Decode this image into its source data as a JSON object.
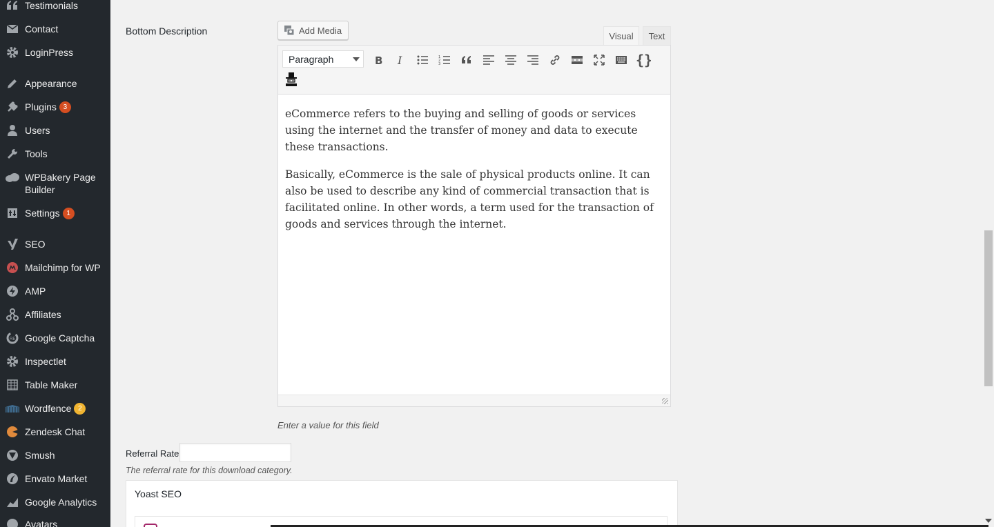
{
  "sidebar": {
    "items": [
      {
        "label": "Testimonials",
        "icon": "quote-icon",
        "badge": ""
      },
      {
        "label": "Contact",
        "icon": "envelope-icon",
        "badge": ""
      },
      {
        "label": "LoginPress",
        "icon": "gear-icon",
        "badge": ""
      },
      {
        "label": "Appearance",
        "icon": "paintbrush-icon",
        "badge": ""
      },
      {
        "label": "Plugins",
        "icon": "plug-icon",
        "badge": "3"
      },
      {
        "label": "Users",
        "icon": "user-icon",
        "badge": ""
      },
      {
        "label": "Tools",
        "icon": "wrench-icon",
        "badge": ""
      },
      {
        "label": "WPBakery Page Builder",
        "icon": "cloud-icon",
        "badge": ""
      },
      {
        "label": "Settings",
        "icon": "settings-icon",
        "badge": "1"
      },
      {
        "label": "SEO",
        "icon": "yoast-icon",
        "badge": ""
      },
      {
        "label": "Mailchimp for WP",
        "icon": "mailchimp-icon",
        "badge": ""
      },
      {
        "label": "AMP",
        "icon": "bolt-icon",
        "badge": ""
      },
      {
        "label": "Affiliates",
        "icon": "network-icon",
        "badge": ""
      },
      {
        "label": "Google Captcha",
        "icon": "recaptcha-icon",
        "badge": ""
      },
      {
        "label": "Inspectlet",
        "icon": "gear-icon",
        "badge": ""
      },
      {
        "label": "Table Maker",
        "icon": "table-icon",
        "badge": ""
      },
      {
        "label": "Wordfence",
        "icon": "wordfence-icon",
        "badge": "2"
      },
      {
        "label": "Zendesk Chat",
        "icon": "zendesk-icon",
        "badge": ""
      },
      {
        "label": "Smush",
        "icon": "smush-icon",
        "badge": ""
      },
      {
        "label": "Envato Market",
        "icon": "leaf-icon",
        "badge": ""
      },
      {
        "label": "Google Analytics",
        "icon": "chart-icon",
        "badge": ""
      },
      {
        "label": "Avatars",
        "icon": "avatar-icon",
        "badge": ""
      }
    ]
  },
  "fields": {
    "bottom_description_label": "Bottom Description",
    "add_media_label": "Add Media",
    "tab_visual": "Visual",
    "tab_text": "Text",
    "format_select_value": "Paragraph",
    "content_paragraphs": [
      "eCommerce refers to the buying and selling of goods or services using the internet and the transfer of money and data to execute these transactions.",
      "Basically, eCommerce is the sale of physical products online. It can also be used to describe any kind of commercial transaction that is facilitated online. In other words, a term used for the transaction of goods and services through the internet."
    ],
    "editor_hint": "Enter a value for this field",
    "referral_rate_label": "Referral Rate",
    "referral_rate_value": "",
    "referral_rate_hint": "The referral rate for this download category."
  },
  "yoast": {
    "title": "Yoast SEO"
  },
  "toolbar": {
    "buttons": [
      "bold-icon",
      "italic-icon",
      "bullet-list-icon",
      "numbered-list-icon",
      "blockquote-icon",
      "align-left-icon",
      "align-center-icon",
      "align-right-icon",
      "link-icon",
      "read-more-icon",
      "fullscreen-icon",
      "keyboard-icon",
      "code-braces-icon",
      "spy-icon"
    ]
  },
  "colors": {
    "sidebar_bg": "#23282d",
    "badge": "#d54e21",
    "badge_warn": "#f0b431",
    "page_bg": "#f1f1f1"
  }
}
